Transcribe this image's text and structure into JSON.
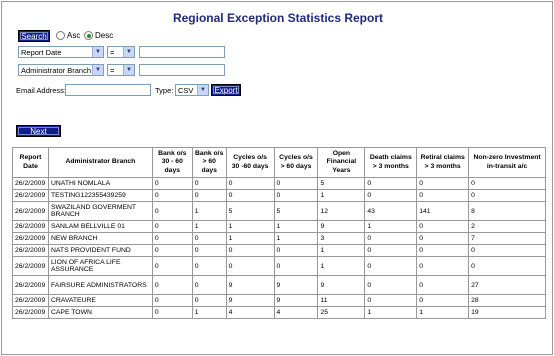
{
  "title": "Regional Exception Statistics Report",
  "search_button": "Search",
  "sort": {
    "asc": "Asc",
    "desc": "Desc",
    "selected": "desc"
  },
  "filters": [
    {
      "field": "Report Date",
      "operator": "=",
      "value": ""
    },
    {
      "field": "Administrator Branch",
      "operator": "=",
      "value": ""
    }
  ],
  "email": {
    "label": "Email Address:",
    "value": ""
  },
  "type": {
    "label": "Type:",
    "value": "CSV"
  },
  "export_button": "Export",
  "next_button": "Next",
  "columns": [
    "Report Date",
    "Administrator Branch",
    "Bank o/s 30 - 60 days",
    "Bank o/s > 60 days",
    "Cycles o/s 30 -60 days",
    "Cycles o/s > 60 days",
    "Open Financial Years",
    "Death claims > 3 months",
    "Retiral claims > 3 months",
    "Non-zero Investment in-transit a/c"
  ],
  "rows": [
    [
      "26/2/2009",
      "UNATHI NOMLALA",
      "0",
      "0",
      "0",
      "0",
      "5",
      "0",
      "0",
      "0"
    ],
    [
      "26/2/2009",
      "TESTING122355439259",
      "0",
      "0",
      "0",
      "0",
      "1",
      "0",
      "0",
      "0"
    ],
    [
      "26/2/2009",
      "SWAZILAND GOVERMENT BRANCH",
      "0",
      "1",
      "5",
      "5",
      "12",
      "43",
      "141",
      "8"
    ],
    [
      "26/2/2009",
      "SANLAM BELLVILLE 01",
      "0",
      "1",
      "1",
      "1",
      "9",
      "1",
      "0",
      "2"
    ],
    [
      "26/2/2009",
      "NEW BRANCH",
      "0",
      "0",
      "1",
      "1",
      "3",
      "0",
      "0",
      "7"
    ],
    [
      "26/2/2009",
      "NATS PROVIDENT FUND",
      "0",
      "0",
      "0",
      "0",
      "1",
      "0",
      "0",
      "0"
    ],
    [
      "26/2/2009",
      "LION OF AFRICA LIFE ASSURANCE",
      "0",
      "0",
      "0",
      "0",
      "1",
      "0",
      "0",
      "0"
    ],
    [
      "26/2/2009",
      "FAIRSURE ADMINISTRATORS",
      "0",
      "0",
      "9",
      "9",
      "9",
      "0",
      "0",
      "27"
    ],
    [
      "26/2/2009",
      "CRAVATEURE",
      "0",
      "0",
      "9",
      "9",
      "11",
      "0",
      "0",
      "28"
    ],
    [
      "26/2/2009",
      "CAPE TOWN",
      "0",
      "1",
      "4",
      "4",
      "25",
      "1",
      "1",
      "19"
    ]
  ]
}
